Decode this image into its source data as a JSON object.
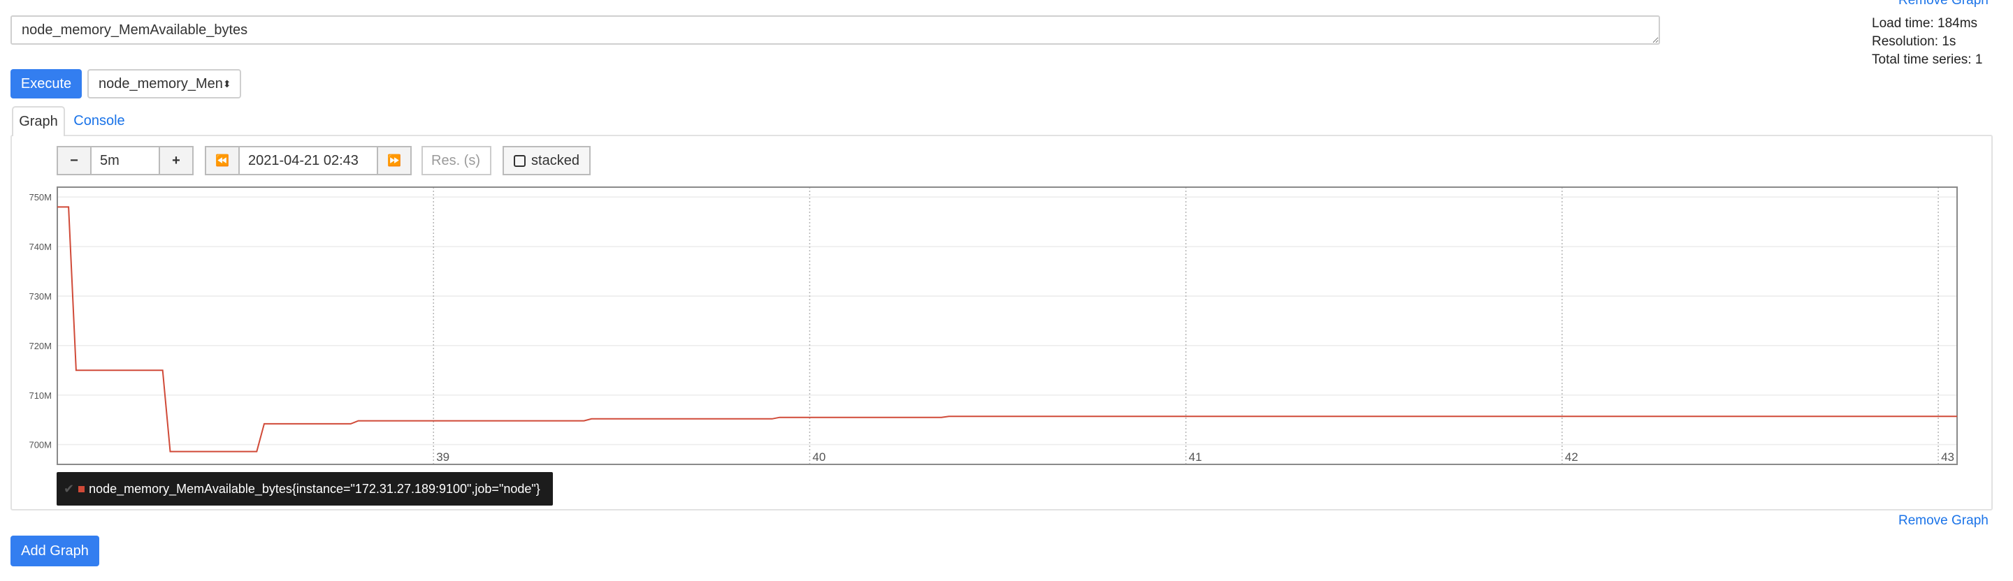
{
  "header": {
    "remove_graph_top": "Remove Graph"
  },
  "expression": {
    "value": "node_memory_MemAvailable_bytes"
  },
  "stats": {
    "load_time": "Load time: 184ms",
    "resolution": "Resolution: 1s",
    "total_series": "Total time series: 1"
  },
  "toolbar": {
    "execute_label": "Execute",
    "metric_select_value": "node_memory_Men",
    "metric_select_caret": "⬍"
  },
  "tabs": {
    "graph": "Graph",
    "console": "Console"
  },
  "graph_controls": {
    "minus": "−",
    "range": "5m",
    "plus": "+",
    "back": "⏪",
    "end_time": "2021-04-21 02:43",
    "forward": "⏩",
    "resolution_placeholder": "Res. (s)",
    "stacked_label": "stacked"
  },
  "legend": {
    "check": "✔",
    "series_label": "node_memory_MemAvailable_bytes{instance=\"172.31.27.189:9100\",job=\"node\"}",
    "color": "#d04a38"
  },
  "footer": {
    "remove_graph": "Remove Graph",
    "add_graph": "Add Graph"
  },
  "chart_data": {
    "type": "line",
    "series": [
      {
        "name": "node_memory_MemAvailable_bytes{instance=\"172.31.27.189:9100\",job=\"node\"}",
        "x": [
          38.0,
          38.03,
          38.05,
          38.28,
          38.3,
          38.53,
          38.55,
          38.78,
          38.8,
          39.4,
          39.42,
          39.9,
          39.92,
          40.35,
          40.37,
          43.05
        ],
        "y": [
          748,
          748,
          715,
          715,
          698.6,
          698.6,
          704.2,
          704.2,
          704.8,
          704.8,
          705.2,
          705.2,
          705.5,
          705.5,
          705.7,
          705.7
        ],
        "color": "#d04a38"
      }
    ],
    "x_ticks": [
      "39",
      "40",
      "41",
      "42",
      "43"
    ],
    "y_ticks": [
      "750M",
      "740M",
      "730M",
      "720M",
      "710M",
      "700M"
    ],
    "xlim": [
      38.0,
      43.05
    ],
    "ylim": [
      696,
      752
    ],
    "grid": true
  }
}
